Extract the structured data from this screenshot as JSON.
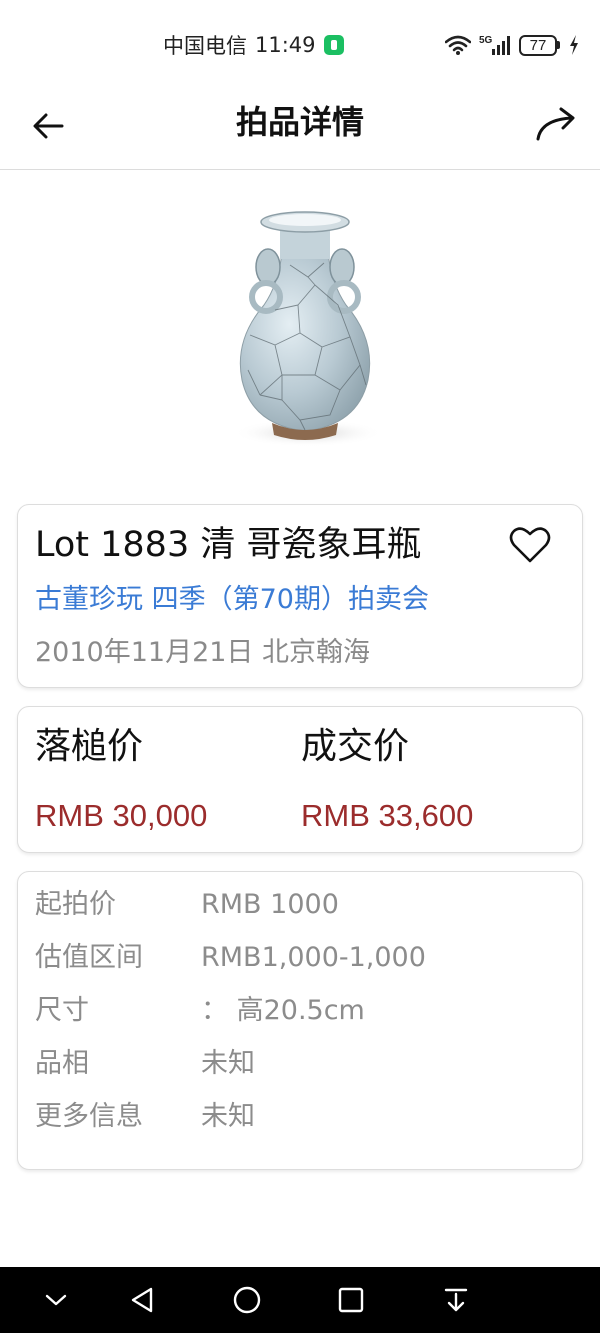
{
  "status_bar": {
    "carrier": "中国电信",
    "time": "11:49",
    "network": "5G",
    "battery": "77"
  },
  "header": {
    "title": "拍品详情"
  },
  "lot": {
    "title": "Lot 1883 清 哥瓷象耳瓶",
    "session": "古董珍玩 四季（第70期）拍卖会",
    "meta": "2010年11月21日 北京翰海"
  },
  "prices": {
    "hammer_label": "落槌价",
    "hammer_value": "RMB 30,000",
    "final_label": "成交价",
    "final_value": "RMB 33,600"
  },
  "info": [
    {
      "label": "起拍价",
      "value": "RMB 1000"
    },
    {
      "label": "估值区间",
      "value": "RMB1,000-1,000"
    },
    {
      "label": "尺寸",
      "value": "：  高20.5cm"
    },
    {
      "label": "品相",
      "value": "未知"
    },
    {
      "label": "更多信息",
      "value": "未知"
    }
  ],
  "colors": {
    "link": "#3a7bd5",
    "price": "#9b2c2c",
    "muted": "#8c8c8c"
  },
  "icons": {
    "back": "arrow-left-icon",
    "share": "share-arrow-icon",
    "favorite": "heart-outline-icon"
  }
}
